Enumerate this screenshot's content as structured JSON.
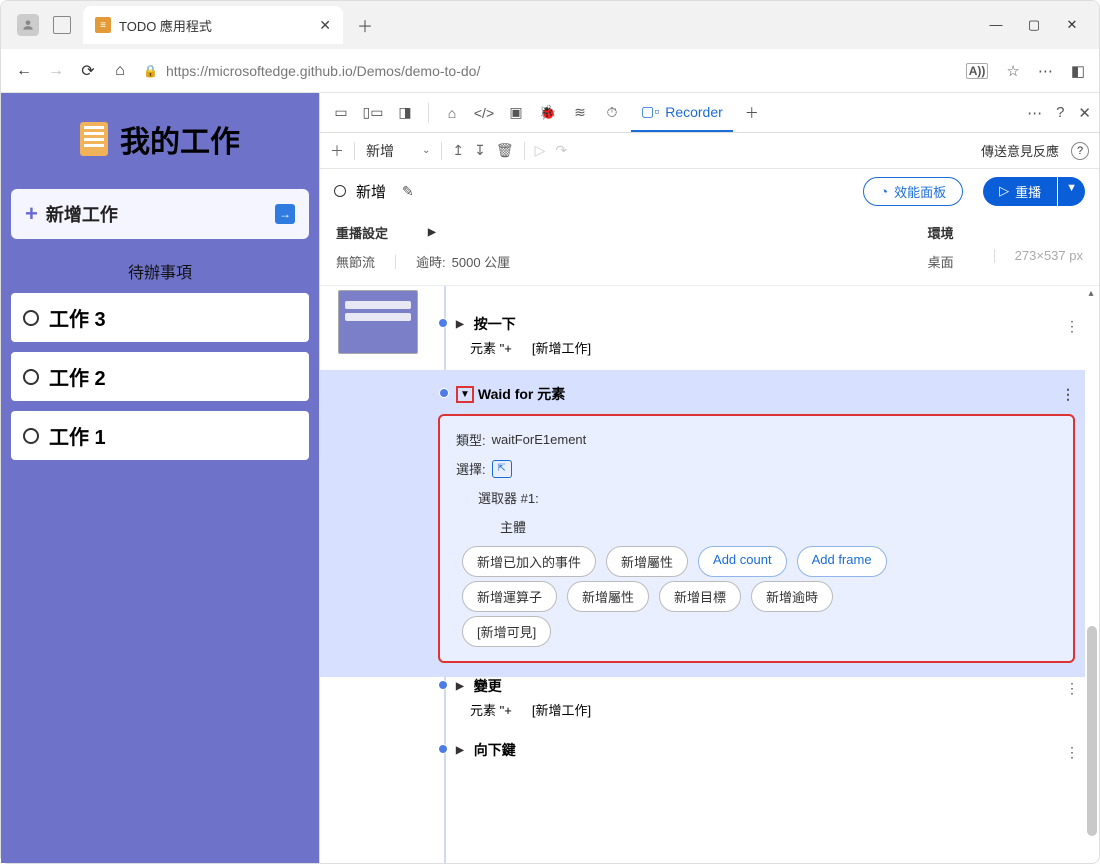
{
  "window": {
    "minimize": "—",
    "maximize": "▢",
    "close": "✕"
  },
  "tab": {
    "title": "TODO 應用程式"
  },
  "url": "https://microsoftedge.github.io/Demos/demo-to-do/",
  "url_reader": "A))",
  "app": {
    "title": "我的工作",
    "add_label": "新增工作",
    "section": "待辦事項",
    "tasks": [
      "工作 3",
      "工作 2",
      "工作 1"
    ]
  },
  "devtools": {
    "recorder_tab": "Recorder",
    "toolbar": {
      "new_dropdown": "新增",
      "feedback": "傳送意見反應"
    },
    "recording": {
      "name": "新增",
      "perf_panel": "效能面板",
      "replay": "重播"
    },
    "settings": {
      "replay_head": "重播設定",
      "throttling": "無節流",
      "timeout_label": "逾時:",
      "timeout_value": "5000 公厘",
      "env_head": "環境",
      "env_value": "桌面",
      "dims": "273×537 px"
    },
    "steps": {
      "click": {
        "title": "按一下",
        "sub1": "元素 \"+",
        "sub2": "[新增工作]"
      },
      "wait": {
        "title": "Waid for 元素",
        "type_label": "類型:",
        "type_value": "waitForE1ement",
        "select_label": "選擇:",
        "selector_label": "選取器 #1:",
        "body": "主體",
        "pills_r1": [
          "新增已加入的事件",
          "新增屬性",
          "Add count",
          "Add frame"
        ],
        "pills_r2": [
          "新增運算子",
          "新增屬性",
          "新增目標",
          "新增逾時"
        ],
        "pills_r3": [
          "[新增可見]"
        ]
      },
      "change": {
        "title": "變更",
        "sub1": "元素 \"+",
        "sub2": "[新增工作]"
      },
      "keydown": {
        "title": "向下鍵"
      }
    }
  }
}
